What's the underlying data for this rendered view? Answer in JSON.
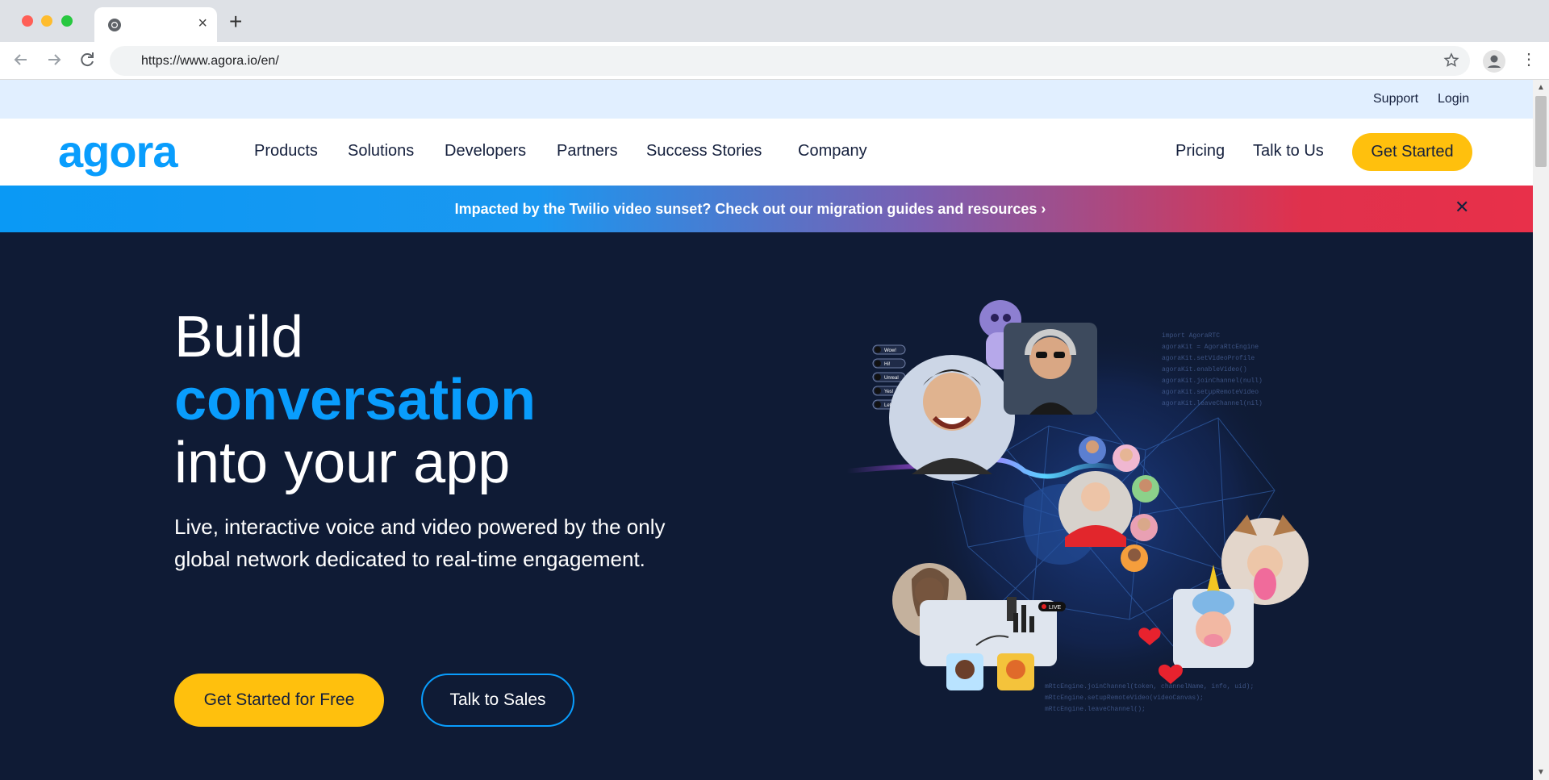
{
  "browser": {
    "url": "https://www.agora.io/en/",
    "tab_close": "×",
    "new_tab": "+",
    "menu": "⋮"
  },
  "site": {
    "logo": "agora",
    "utility_links": [
      "Support",
      "Login"
    ],
    "nav_items": [
      "Products",
      "Solutions",
      "Developers",
      "Partners",
      "Success Stories",
      "Company"
    ],
    "pricing": "Pricing",
    "talk_to_us": "Talk to Us",
    "get_started": "Get Started"
  },
  "banner": {
    "message": "Impacted by the Twilio video sunset? Check out our migration guides and resources ›",
    "close": "✕"
  },
  "hero": {
    "line1": "Build",
    "line2": "conversation",
    "line3": "into your app",
    "subtitle": "Live, interactive voice and video powered by the only global network dedicated to real-time engagement.",
    "cta_primary": "Get Started for Free",
    "cta_secondary": "Talk to Sales"
  },
  "illustration": {
    "chat_pills": [
      "Wow!",
      "Hi!",
      "Unreal",
      "Yes!",
      "Let's go!"
    ],
    "live_badge": "LIVE"
  },
  "colors": {
    "brand_blue": "#099dfd",
    "accent_yellow": "#ffc00d",
    "hero_bg": "#0f1b35",
    "banner_red": "#e0314c"
  }
}
